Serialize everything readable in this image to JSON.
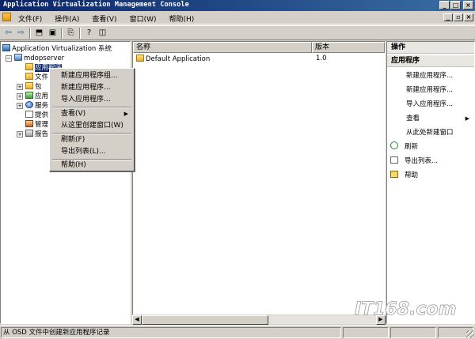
{
  "window": {
    "title": "Application Virtualization Management Console"
  },
  "menu": [
    {
      "label": "文件(F)"
    },
    {
      "label": "操作(A)"
    },
    {
      "label": "查看(V)"
    },
    {
      "label": "窗口(W)"
    },
    {
      "label": "帮助(H)"
    }
  ],
  "tree": {
    "root_label": "Application Virtualization 系统",
    "server_label": "mdopserver",
    "items": [
      {
        "label": "应用程序",
        "icon": "folder-icon"
      },
      {
        "label": "文件",
        "icon": "folder-icon"
      },
      {
        "label": "包",
        "icon": "folder-icon"
      },
      {
        "label": "应用",
        "icon": "green-icon"
      },
      {
        "label": "服务",
        "icon": "globe-icon"
      },
      {
        "label": "提供",
        "icon": "doc-icon"
      },
      {
        "label": "管理",
        "icon": "people-icon"
      },
      {
        "label": "报告",
        "icon": "report-icon"
      }
    ]
  },
  "list": {
    "columns": [
      "名称",
      "版本"
    ],
    "rows": [
      {
        "name": "Default Application",
        "version": "1.0"
      }
    ]
  },
  "actions": {
    "header": "操作",
    "section": "应用程序",
    "items": [
      {
        "label": "新建应用程序..."
      },
      {
        "label": "新建应用程序..."
      },
      {
        "label": "导入应用程序..."
      },
      {
        "label": "查看"
      },
      {
        "label": "从此处新建窗口"
      },
      {
        "label": "刷新"
      },
      {
        "label": "导出列表..."
      },
      {
        "label": "帮助"
      }
    ]
  },
  "context_menu": {
    "items": [
      {
        "label": "新建应用程序组..."
      },
      {
        "label": "新建应用程序..."
      },
      {
        "label": "导入应用程序..."
      },
      {
        "label": "查看(V)"
      },
      {
        "label": "从这里创建窗口(W)"
      },
      {
        "label": "刷新(F)"
      },
      {
        "label": "导出列表(L)..."
      },
      {
        "label": "帮助(H)"
      }
    ]
  },
  "statusbar": {
    "text": "从 OSD 文件中创建新应用程序记录"
  },
  "watermark": {
    "text": "IT168.com"
  },
  "colors": {
    "titlebar": "#0a246a",
    "selection": "#0a246a",
    "chrome": "#d4d0c8"
  }
}
